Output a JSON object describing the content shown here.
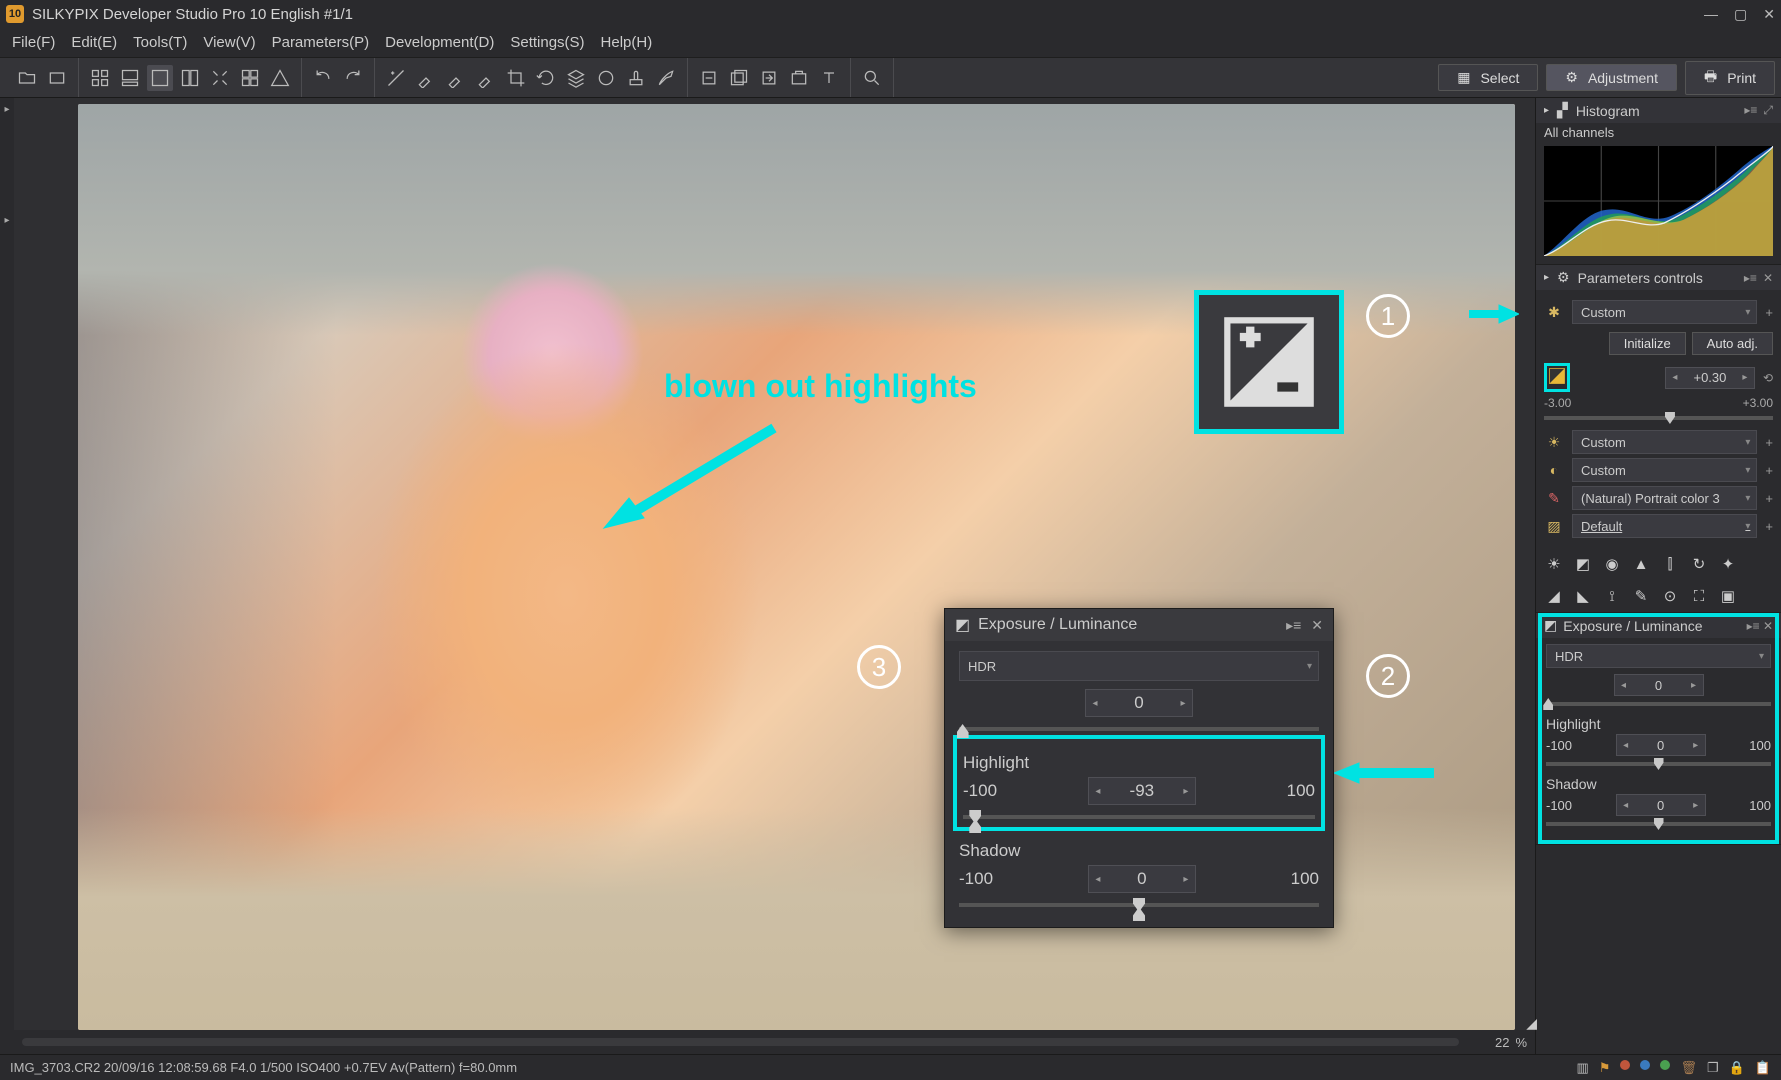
{
  "window": {
    "title": "SILKYPIX Developer Studio Pro 10 English  #1/1"
  },
  "menu": {
    "items": [
      "File(F)",
      "Edit(E)",
      "Tools(T)",
      "View(V)",
      "Parameters(P)",
      "Development(D)",
      "Settings(S)",
      "Help(H)"
    ]
  },
  "mode_buttons": {
    "select": "Select",
    "adjustment": "Adjustment",
    "print": "Print"
  },
  "canvas": {
    "zoom": "22",
    "zoom_unit": "%"
  },
  "annotation": {
    "highlights_text": "blown out highlights"
  },
  "right": {
    "histogram": {
      "title": "Histogram",
      "channels": "All channels"
    },
    "params": {
      "title": "Parameters controls",
      "preset": "Custom",
      "initialize": "Initialize",
      "auto": "Auto adj.",
      "exposure_value": "+0.30",
      "exposure_min": "-3.00",
      "exposure_max": "+3.00",
      "wb_preset": "Custom",
      "tone_preset": "Custom",
      "color_preset": "(Natural) Portrait color 3",
      "nr_preset": "Default"
    },
    "el": {
      "title": "Exposure / Luminance",
      "hdr_label": "HDR",
      "hdr_value": "0",
      "highlight_label": "Highlight",
      "highlight_value": "0",
      "highlight_min": "-100",
      "highlight_max": "100",
      "shadow_label": "Shadow",
      "shadow_value": "0",
      "shadow_min": "-100",
      "shadow_max": "100"
    }
  },
  "float_panel": {
    "title": "Exposure / Luminance",
    "hdr_label": "HDR",
    "hdr_value": "0",
    "highlight_label": "Highlight",
    "highlight_value": "-93",
    "highlight_min": "-100",
    "highlight_max": "100",
    "shadow_label": "Shadow",
    "shadow_value": "0",
    "shadow_min": "-100",
    "shadow_max": "100"
  },
  "status": {
    "text": "IMG_3703.CR2 20/09/16 12:08:59.68 F4.0 1/500 ISO400 +0.7EV Av(Pattern) f=80.0mm"
  }
}
